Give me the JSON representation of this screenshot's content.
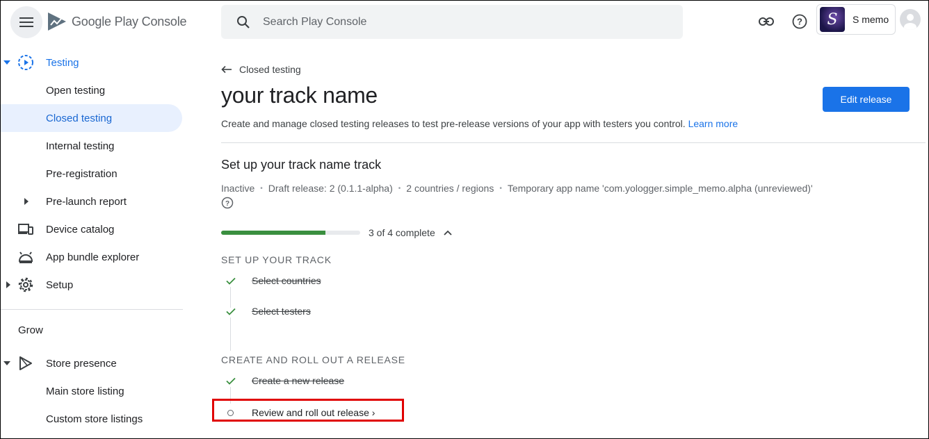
{
  "header": {
    "logo_text": "Google Play Console",
    "search_placeholder": "Search Play Console",
    "app_name": "S memo",
    "app_initial": "S"
  },
  "sidebar": {
    "items": [
      {
        "label": "Testing",
        "icon": "testing-icon"
      },
      {
        "label": "Open testing"
      },
      {
        "label": "Closed testing"
      },
      {
        "label": "Internal testing"
      },
      {
        "label": "Pre-registration"
      },
      {
        "label": "Pre-launch report"
      },
      {
        "label": "Device catalog",
        "icon": "devices-icon"
      },
      {
        "label": "App bundle explorer",
        "icon": "android-icon"
      },
      {
        "label": "Setup",
        "icon": "gear-icon"
      }
    ],
    "section_grow": "Grow",
    "grow_items": [
      {
        "label": "Store presence",
        "icon": "play-icon"
      },
      {
        "label": "Main store listing"
      },
      {
        "label": "Custom store listings"
      }
    ]
  },
  "main": {
    "back_label": "Closed testing",
    "title": "your track name",
    "edit_button": "Edit release",
    "description": "Create and manage closed testing releases to test pre-release versions of your app with testers you control.",
    "learn_more": "Learn more",
    "section_title": "Set up your track name track",
    "meta": [
      "Inactive",
      "Draft release: 2 (0.1.1-alpha)",
      "2 countries / regions",
      "Temporary app name 'com.yologger.simple_memo.alpha (unreviewed)'"
    ],
    "progress_text": "3 of 4 complete",
    "progress_fraction": 0.75,
    "group1_title": "SET UP YOUR TRACK",
    "group1_steps": [
      "Select countries",
      "Select testers"
    ],
    "group2_title": "CREATE AND ROLL OUT A RELEASE",
    "group2_steps": [
      "Create a new release"
    ],
    "pending_step": "Review and roll out release ›"
  },
  "colors": {
    "accent": "#1a73e8",
    "selected_bg": "#e8f0fe",
    "progress": "#3a8f3f",
    "highlight": "#e00000"
  }
}
